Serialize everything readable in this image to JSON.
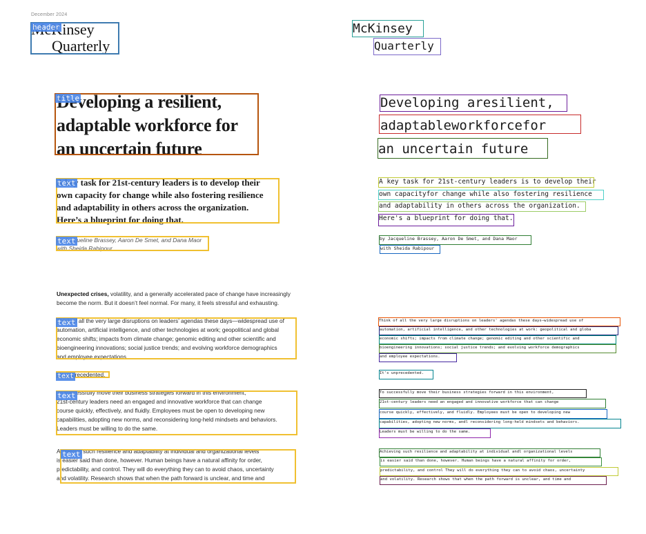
{
  "left": {
    "date": "December 2024",
    "logo": {
      "line1": "McKinsey",
      "line2": "Quarterly"
    },
    "title": [
      "Developing a resilient,",
      "adaptable workforce for",
      "an uncertain future"
    ],
    "lead": [
      "A key task for 21st-century leaders is to develop their",
      "own capacity for change while also fostering resilience",
      "and adaptability in others across the organization.",
      "Here’s a blueprint for doing that."
    ],
    "authors": [
      "by Jacqueline Brassey, Aaron De Smet, and Dana Maor",
      "with Sheida Rabipour"
    ],
    "intro_bold": "Unexpected crises,",
    "intro_rest_1": "volatility, and a generally accelerated pace of change have increasingly",
    "intro_rest_2": "become the norm. But it doesn’t feel normal. For many, it feels stressful and exhausting.",
    "para1": [
      "Think of all the very large disruptions on leaders’ agendas these days—widespread use of",
      "automation, artificial intelligence, and other technologies at work; geopolitical and global",
      "economic shifts; impacts from climate change; genomic editing and other scientific and",
      "bioengineering innovations; social justice trends; and evolving workforce demographics",
      "and employee expectations."
    ],
    "para2": "It’s unprecedented.",
    "para3": [
      "To successfully move their business strategies forward in this environment,",
      "21st-century leaders need an engaged and innovative workforce that can change",
      "course quickly, effectively, and fluidly. Employees must be open to developing new",
      "capabilities, adopting new norms, and reconsidering long-held mindsets and behaviors.",
      "Leaders must be willing to do the same."
    ],
    "para4": [
      "Achieving such resilience and adaptability at individual and organizational levels",
      "is easier said than done, however. Human beings have a natural affinity for order,",
      "predictability, and control. They will do everything they can to avoid chaos, uncertainty",
      "and volatility. Research shows that when the path forward is unclear, and time and"
    ],
    "tags": {
      "header": "header",
      "title": "title",
      "text": "text"
    }
  },
  "right": {
    "logo": {
      "line1": "McKinsey",
      "line2": "Quarterly"
    },
    "title": [
      "Developing aresilient,",
      "adaptableworkforcefor",
      "an uncertain future"
    ],
    "lead": [
      "A key task for 21st-century leaders is to develop their",
      "own capacityfor change while also fostering resilience",
      "and adaptability in others across the organization.",
      "Here's a blueprint for doing that."
    ],
    "authors": [
      "by Jacqueline Brassey, Aaron De Smet, and Dana Maor",
      "with Sheida Rabipour"
    ],
    "para1": [
      "Think of all the very large disruptions on leaders' agendas these days—widespread use of",
      "automation, artificial intelligence, and other technologies at work: geopolitical and globa",
      "economic shifts; impacts from climate change; genomic editing and other scientific and",
      "bioengineering innovations; social justice trends; and evolving workforce demographics",
      "and employee expectations."
    ],
    "para2": "It's unprecedented.",
    "para3": [
      "To successfully move their business strategies forward in this environment,",
      "21st-century leaders need an engaged and innovative workforce that can change",
      "course quickly, effectively, and fluidly. Employees must be open to developing new",
      "capabilities, adopting new norms, andl reconsidering long-held mindsets and behaviors.",
      "Leaders must be willing to do the same."
    ],
    "para4": [
      "Achieving such resilience and adaptability at individual andl organizational levels",
      "is easier said than done, however. Human beings have a natural affinity for order,",
      "predictability, and control They will do everything they can to avoid chaos, uncertainty",
      "and volatility. Research shows that when the path forward is unclear, and time and"
    ]
  },
  "colors": {
    "header_box": "#3d7ab0",
    "title_box": "#b5540c",
    "text_box": "#f0c030",
    "tag_bg": "#4a86e8"
  }
}
